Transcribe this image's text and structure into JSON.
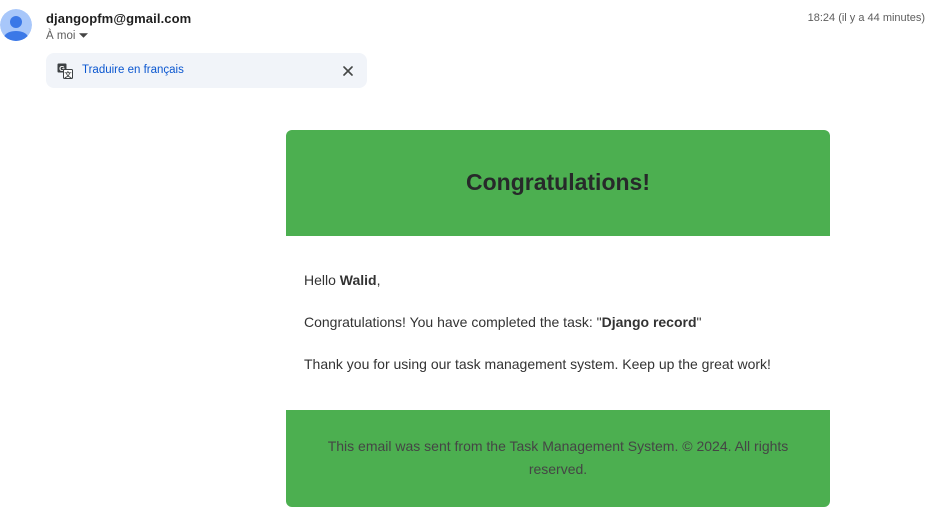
{
  "header": {
    "sender": "djangopfm@gmail.com",
    "recipient": "À moi",
    "timestamp": "18:24 (il y a 44 minutes)",
    "avatar_color": "#4285f4"
  },
  "translate": {
    "link_label": "Traduire en français",
    "icon": "translate-icon",
    "close_icon": "close-icon"
  },
  "email": {
    "title": "Congratulations!",
    "greeting": {
      "prefix": "Hello ",
      "name": "Walid",
      "suffix": ","
    },
    "message": {
      "prefix": "Congratulations! You have completed the task: \"",
      "task": "Django record",
      "suffix": "\""
    },
    "thanks": "Thank you for using our task management system. Keep up the great work!",
    "footer": "This email was sent from the Task Management System. © 2024. All rights reserved.",
    "accent_color": "#4caf50"
  }
}
